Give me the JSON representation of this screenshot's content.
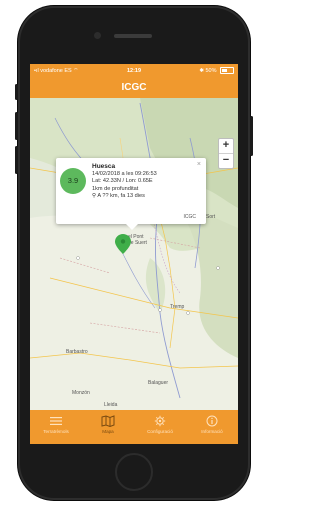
{
  "status_bar": {
    "carrier": "vodafone ES",
    "time": "12:19",
    "battery": "50%"
  },
  "app": {
    "title": "ICGC"
  },
  "zoom": {
    "in_label": "+",
    "out_label": "−"
  },
  "popup": {
    "magnitude": "3.9",
    "place": "Huesca",
    "datetime": "14/02/2018 a les 09:26:53",
    "coords": "Lat: 42.33N / Lon: 0.65E",
    "depth": "1km de profunditat",
    "distance": "A ?? km, fa 13 dies",
    "credit": "ICGC",
    "close": "×"
  },
  "map_labels": {
    "pont_de_suert": "el Pont\nde Suert",
    "tremp": "Tremp",
    "balaguer": "Balaguer",
    "sort": "Sort",
    "barbastro": "Barbastro",
    "monzon": "Monzón",
    "lleida": "Lleida"
  },
  "tabs": [
    {
      "label": "Terratrèmols",
      "icon": "list-icon",
      "active": false
    },
    {
      "label": "Mapa",
      "icon": "map-icon",
      "active": true
    },
    {
      "label": "Configuració",
      "icon": "gear-icon",
      "active": false
    },
    {
      "label": "Informació",
      "icon": "info-icon",
      "active": false
    }
  ],
  "colors": {
    "accent": "#f0992e",
    "magnitude_green": "#5db95d",
    "marker_green": "#3fae49"
  }
}
